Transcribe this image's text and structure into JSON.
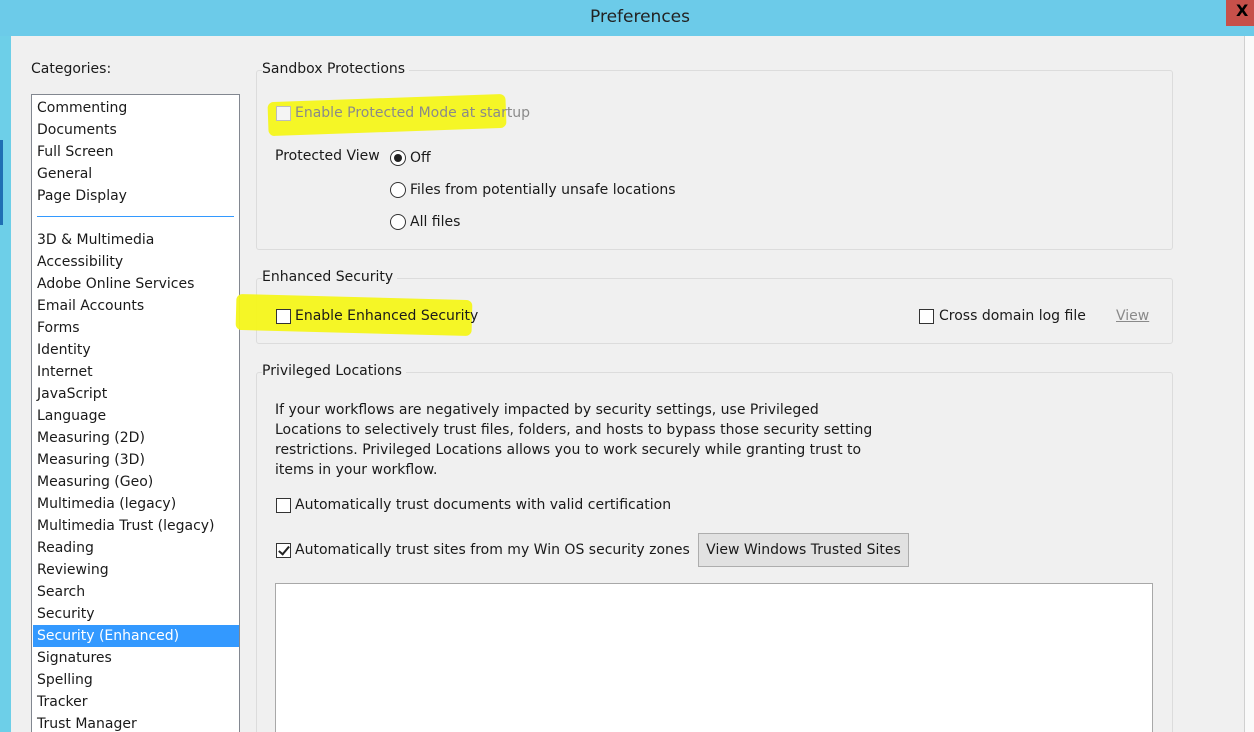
{
  "window": {
    "title": "Preferences",
    "close_label": "X"
  },
  "categories": {
    "label": "Categories:",
    "top_items": [
      "Commenting",
      "Documents",
      "Full Screen",
      "General",
      "Page Display"
    ],
    "items": [
      "3D & Multimedia",
      "Accessibility",
      "Adobe Online Services",
      "Email Accounts",
      "Forms",
      "Identity",
      "Internet",
      "JavaScript",
      "Language",
      "Measuring (2D)",
      "Measuring (3D)",
      "Measuring (Geo)",
      "Multimedia (legacy)",
      "Multimedia Trust (legacy)",
      "Reading",
      "Reviewing",
      "Search",
      "Security",
      "Security (Enhanced)",
      "Signatures",
      "Spelling",
      "Tracker",
      "Trust Manager"
    ],
    "selected": "Security (Enhanced)"
  },
  "sandbox": {
    "title": "Sandbox Protections",
    "protected_mode_label": "Enable Protected Mode at startup",
    "protected_mode_checked": false,
    "protected_view_label": "Protected View",
    "protected_view_options": [
      "Off",
      "Files from potentially unsafe locations",
      "All files"
    ],
    "protected_view_selected": "Off"
  },
  "enhanced": {
    "title": "Enhanced Security",
    "enable_label": "Enable Enhanced Security",
    "enable_checked": false,
    "cross_domain_label": "Cross domain log file",
    "cross_domain_checked": false,
    "view_link": "View"
  },
  "privileged": {
    "title": "Privileged Locations",
    "description": "If your workflows are negatively impacted by security settings, use Privileged Locations to selectively trust files, folders, and hosts to bypass those security setting restrictions. Privileged Locations allows you to work securely while granting trust to items in your workflow.",
    "trust_certified_label": "Automatically trust documents with valid certification",
    "trust_certified_checked": false,
    "trust_sites_label": "Automatically trust sites from my Win OS security zones",
    "trust_sites_checked": true,
    "view_sites_button": "View Windows Trusted Sites"
  },
  "colors": {
    "titlebar": "#6ccbe9",
    "selection": "#3399ff",
    "highlight": "#f4f51a"
  }
}
